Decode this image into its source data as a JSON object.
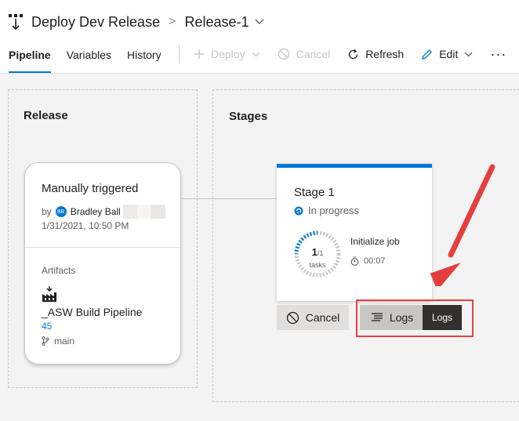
{
  "header": {
    "pipeline_title": "Deploy Dev Release",
    "separator": ">",
    "release_name": "Release-1"
  },
  "tabs": [
    {
      "label": "Pipeline",
      "active": true
    },
    {
      "label": "Variables",
      "active": false
    },
    {
      "label": "History",
      "active": false
    }
  ],
  "toolbar": {
    "deploy_label": "Deploy",
    "cancel_label": "Cancel",
    "refresh_label": "Refresh",
    "edit_label": "Edit",
    "more_label": "···"
  },
  "release_panel": {
    "title": "Release",
    "trigger": "Manually triggered",
    "by_prefix": "by",
    "user_initials": "BB",
    "user_name": "Bradley Ball",
    "date": "1/31/2021, 10:50 PM",
    "artifacts_label": "Artifacts",
    "artifact_name": "_ASW Build Pipeline",
    "artifact_build": "45",
    "branch": "main"
  },
  "stages_panel": {
    "title": "Stages",
    "stage_name": "Stage 1",
    "status": "In progress",
    "tasks_done": "1",
    "tasks_total": "/1",
    "tasks_label": "tasks",
    "current_job": "Initialize job",
    "elapsed": "00:07",
    "cancel_label": "Cancel",
    "logs_label": "Logs",
    "tooltip": "Logs"
  },
  "colors": {
    "accent": "#0078d4",
    "annotation": "#e53e3e",
    "tooltip_bg": "#323130"
  }
}
